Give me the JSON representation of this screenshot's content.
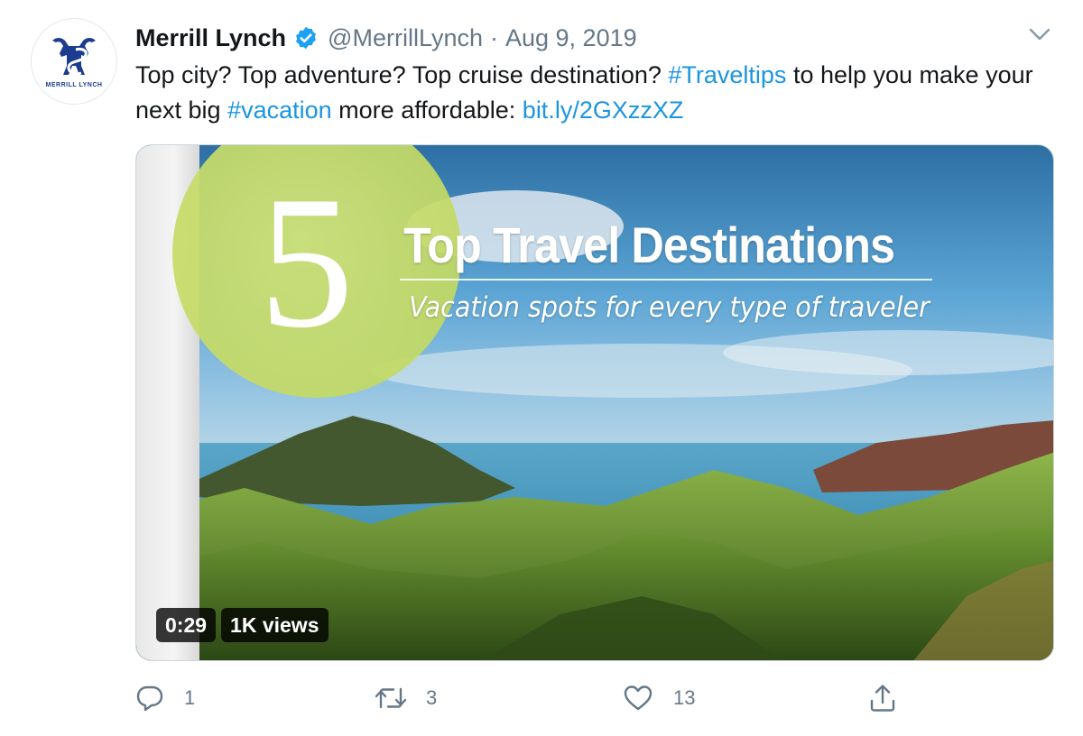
{
  "tweet": {
    "author_name": "Merrill Lynch",
    "handle": "@MerrillLynch",
    "separator": "·",
    "date": "Aug 9, 2019",
    "avatar_text": "MERRILL LYNCH",
    "text": {
      "part1": "Top city? Top adventure? Top cruise destination? ",
      "hashtag1": "#Traveltips",
      "part2": " to help you make your next big ",
      "hashtag2": "#vacation",
      "part3": " more affordable: ",
      "link": "bit.ly/2GXzzXZ"
    }
  },
  "media": {
    "number": "5",
    "title": "Top Travel Destinations",
    "subtitle": "Vacation spots for every type of traveler",
    "duration": "0:29",
    "views": "1K views"
  },
  "actions": {
    "replies": "1",
    "retweets": "3",
    "likes": "13"
  },
  "icons": {
    "verified": "verified-badge-icon",
    "caret": "chevron-down-icon",
    "reply": "reply-icon",
    "retweet": "retweet-icon",
    "like": "heart-icon",
    "share": "share-icon"
  },
  "colors": {
    "link": "#1b95e0",
    "muted": "#657786",
    "brand": "#1b3c8f",
    "verified": "#1da1f2"
  }
}
